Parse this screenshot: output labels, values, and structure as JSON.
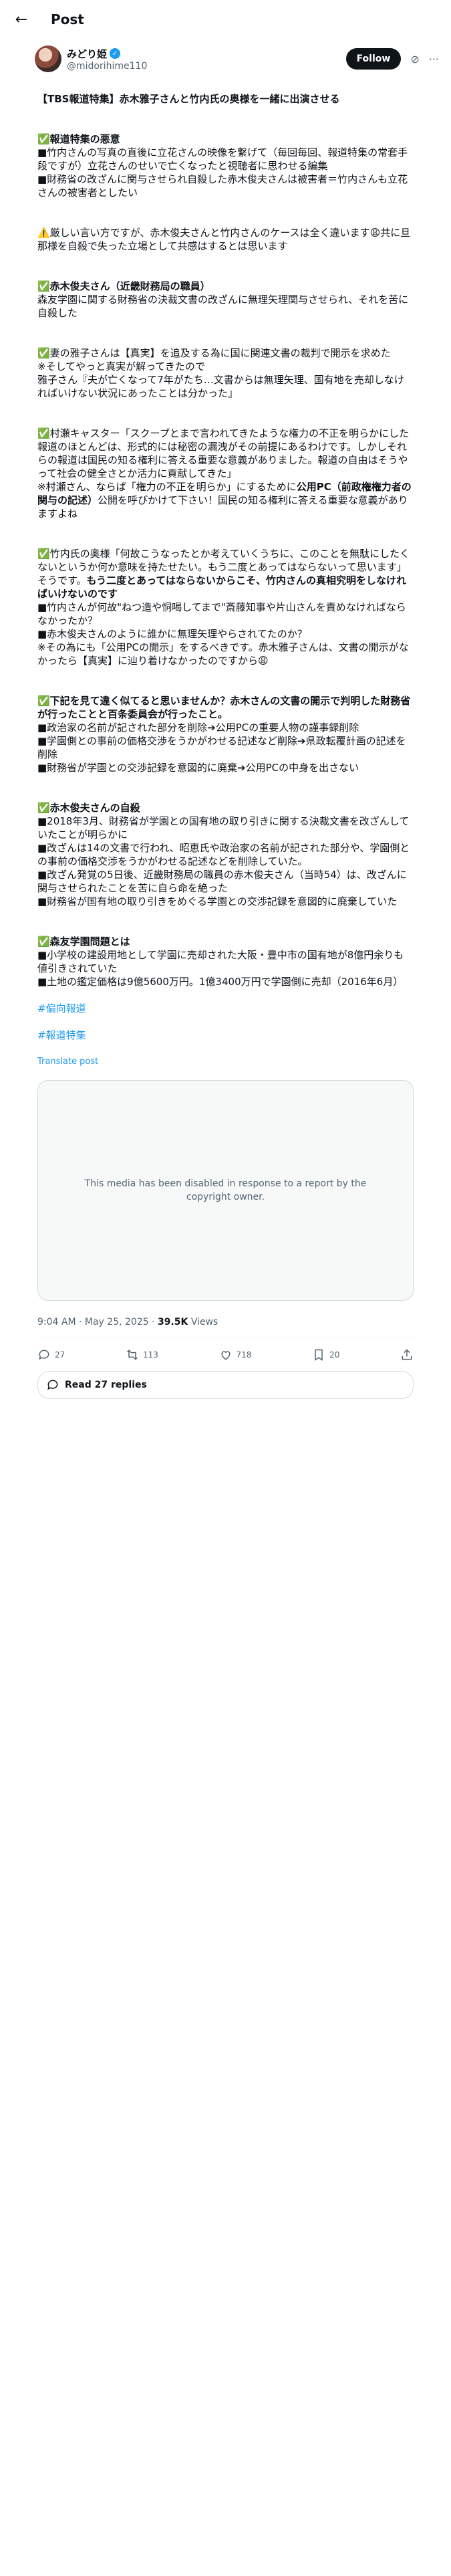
{
  "header": {
    "title": "Post"
  },
  "author": {
    "name": "みどり姫",
    "handle": "@midorihime110"
  },
  "follow_label": "Follow",
  "post": {
    "title": "【TBS報道特集】赤木雅子さんと竹内氏の奥様を一緒に出演させる",
    "s1_head": "✅報道特集の悪意",
    "s1_body": "■竹内さんの写真の直後に立花さんの映像を繋げて（毎回毎回、報道特集の常套手段ですが）立花さんのせいで亡くなったと視聴者に思わせる編集\n■財務省の改ざんに関与させられ自殺した赤木俊夫さんは被害者＝竹内さんも立花さんの被害者としたい",
    "s2_body": "⚠️厳しい言い方ですが、赤木俊夫さんと竹内さんのケースは全く違います😩共に旦那様を自殺で失った立場として共感はするとは思います",
    "s3_head": "✅赤木俊夫さん（近畿財務局の職員）",
    "s3_body": "森友学園に関する財務省の決裁文書の改ざんに無理矢理関与させられ、それを苦に自殺した",
    "s4_body": "✅妻の雅子さんは【真実】を追及する為に国に関連文書の裁判で開示を求めた\n※そしてやっと真実が解ってきたので\n雅子さん『夫が亡くなって7年がたち…文書からは無理矢理、国有地を売却しなければいけない状況にあったことは分かった』",
    "s5_body": "✅村瀬キャスター「スクープとまで言われてきたような権力の不正を明らかにした報道のほとんどは、形式的には秘密の漏洩がその前提にあるわけです。しかしそれらの報道は国民の知る権利に答える重要な意義がありました。報道の自由はそうやって社会の健全さとか活力に貢献してきた」\n※村瀬さん、ならば「権力の不正を明らか」にするために",
    "s5_bold": "公用PC（前政権権力者の関与の記述）",
    "s5_tail": "公開を呼びかけて下さい！国民の知る権利に答える重要な意義がありますよね",
    "s6_body": "✅竹内氏の奥様「何故こうなったとか考えていくうちに、このことを無駄にしたくないというか何か意味を持たせたい。もう二度とあってはならないって思います」\nそうです。",
    "s6_bold": "もう二度とあってはならないからこそ、竹内さんの真相究明をしなければいけないのです",
    "s6_tail": "\n■竹内さんが何故\"ねつ造や恫喝してまで\"斎藤知事や片山さんを責めなければならなかったか？\n■赤木俊夫さんのように誰かに無理矢理やらされてたのか？\n※その為にも「公用PCの開示」をするべきです。赤木雅子さんは、文書の開示がなかったら【真実】に辿り着けなかったのですから😩",
    "s7_head": "✅下記を見て違く似てると思いませんか？赤木さんの文書の開示で判明した財務省が行ったことと百条委員会が行ったこと。",
    "s7_body": "■政治家の名前が記された部分を削除➔公用PCの重要人物の謹事録削除\n■学園側との事前の価格交渉をうかがわせる記述など削除➔県政転覆計画の記述を削除\n■財務省が学園との交渉記録を意図的に廃棄➔公用PCの中身を出さない",
    "s8_head": "✅赤木俊夫さんの自殺",
    "s8_body": "■2018年3月、財務省が学園との国有地の取り引きに関する決裁文書を改ざんしていたことが明らかに\n■改ざんは14の文書で行われ、昭恵氏や政治家の名前が記された部分や、学園側との事前の価格交渉をうかがわせる記述などを削除していた。\n■改ざん発覚の5日後、近畿財務局の職員の赤木俊夫さん（当時54）は、改ざんに関与させられたことを苦に自ら命を絶った\n■財務省が国有地の取り引きをめぐる学園との交渉記録を意図的に廃棄していた",
    "s9_head": "✅森友学園問題とは",
    "s9_body": "■小学校の建設用地として学園に売却された大阪・豊中市の国有地が8億円余りも値引きされていた\n■土地の鑑定価格は9億5600万円。1億3400万円で学園側に売却（2016年6月）",
    "hashtag1": "#偏向報道",
    "hashtag2": "#報道特集"
  },
  "translate_label": "Translate post",
  "media_notice": "This media has been disabled in response to a report by the copyright owner.",
  "meta": {
    "time": "9:04 AM · May 25, 2025 · ",
    "views_count": "39.5K",
    "views_label": " Views"
  },
  "actions": {
    "replies": "27",
    "reposts": "113",
    "likes": "718",
    "bookmarks": "20"
  },
  "read_replies_label": "Read 27 replies"
}
